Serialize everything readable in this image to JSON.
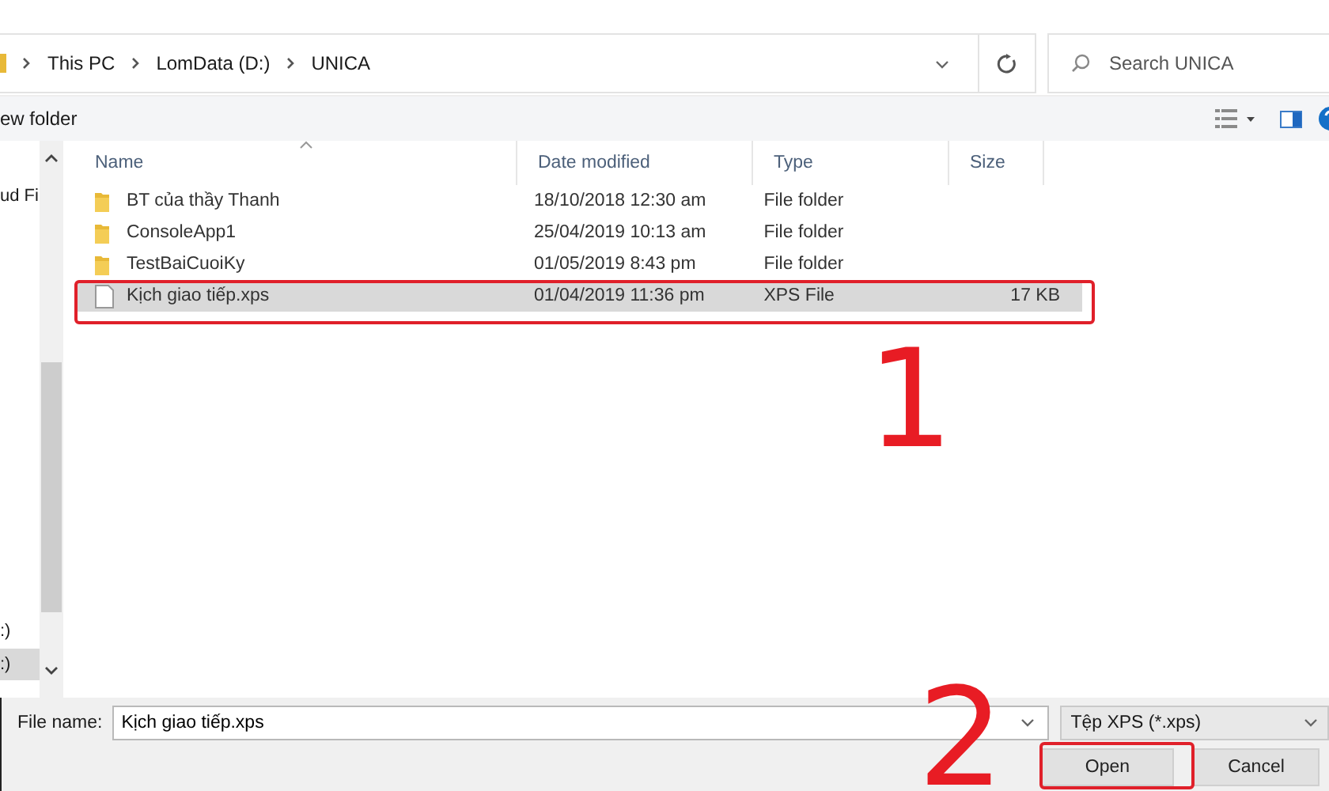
{
  "address_bar": {
    "crumbs": [
      "This PC",
      "LomData (D:)",
      "UNICA"
    ]
  },
  "search": {
    "placeholder": "Search UNICA"
  },
  "toolbar": {
    "new_folder": "ew folder"
  },
  "nav_pane": {
    "items": [
      {
        "label": "ud Fi",
        "selected": false
      },
      {
        "label": ":)",
        "selected": false
      },
      {
        "label": ":)",
        "selected": true
      }
    ]
  },
  "file_list": {
    "columns": [
      "Name",
      "Date modified",
      "Type",
      "Size"
    ],
    "rows": [
      {
        "kind": "folder",
        "name": "BT của thầy Thanh",
        "date": "18/10/2018 12:30 am",
        "type": "File folder",
        "selected": false
      },
      {
        "kind": "folder",
        "name": "ConsoleApp1",
        "date": "25/04/2019 10:13 am",
        "type": "File folder",
        "selected": false
      },
      {
        "kind": "folder",
        "name": "TestBaiCuoiKy",
        "date": "01/05/2019 8:43 pm",
        "type": "File folder",
        "selected": false
      },
      {
        "kind": "file",
        "name": "Kịch giao tiếp.xps",
        "date": "01/04/2019 11:36 pm",
        "type": "XPS File",
        "size": "17 KB",
        "selected": true
      }
    ]
  },
  "footer": {
    "file_name_label": "File name:",
    "file_name": "Kịch giao tiếp.xps",
    "file_type": "Tệp XPS (*.xps)",
    "buttons": [
      "Open",
      "Cancel"
    ]
  },
  "annotations": [
    {
      "label": "1"
    },
    {
      "label": "2"
    }
  ]
}
